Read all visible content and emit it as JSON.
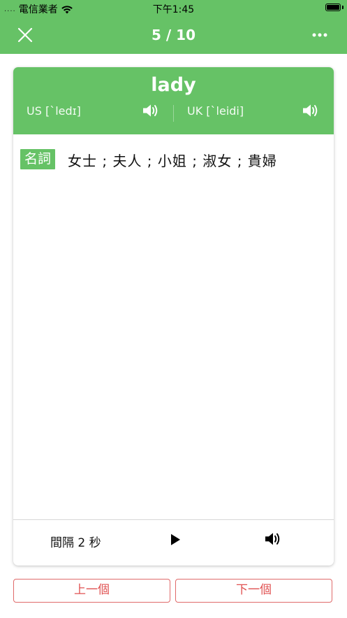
{
  "status_bar": {
    "signal_dots": "....",
    "carrier": "電信業者",
    "time": "下午1:45"
  },
  "nav": {
    "progress": "5 / 10"
  },
  "card": {
    "word": "lady",
    "us_phonetic": "US [`ledɪ]",
    "uk_phonetic": "UK [`leidi]",
    "part_of_speech": "名詞",
    "meaning": "女士 ; 夫人 ; 小姐 ; 淑女 ; 貴婦"
  },
  "controls": {
    "interval": "間隔 2 秒"
  },
  "buttons": {
    "prev": "上一個",
    "next": "下一個"
  },
  "colors": {
    "accent": "#66c266",
    "button_red": "#e05252"
  }
}
